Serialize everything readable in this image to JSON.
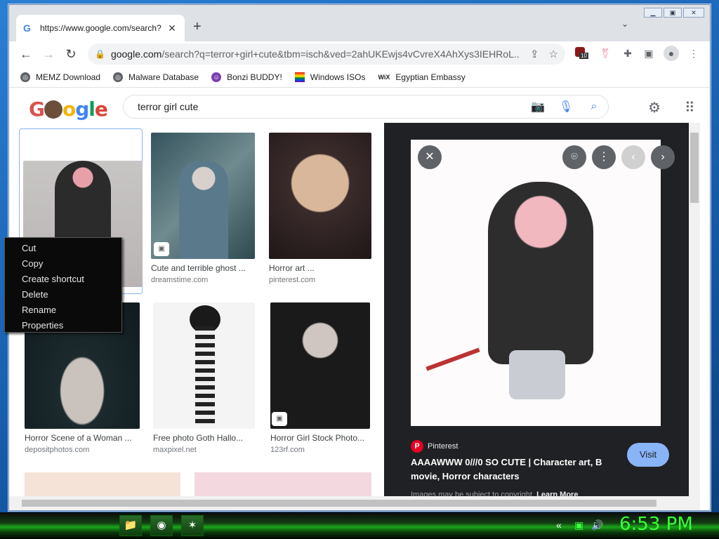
{
  "browser": {
    "tab": {
      "title": "https://www.google.com/search?",
      "favicon": "G"
    },
    "new_tab": "+",
    "tab_close": "✕",
    "caret": "⌄",
    "window_controls": [
      "▁",
      "▣",
      "✕"
    ],
    "url_host": "google.com",
    "url_rest": "/search?q=terror+girl+cute&tbm=isch&ved=2ahUKEwjs4vCvreX4AhXys3IEHRoL...",
    "extension_badge": "10",
    "bookmarks": [
      {
        "label": "MEMZ Download"
      },
      {
        "label": "Malware Database"
      },
      {
        "label": "Bonzi BUDDY!"
      },
      {
        "label": "Windows ISOs"
      },
      {
        "label": "Egyptian Embassy"
      }
    ],
    "bookmark_wix_prefix": "WiX"
  },
  "google": {
    "logo_letters": [
      "G",
      "o",
      "o",
      "g",
      "l",
      "e"
    ],
    "search_query": "terror girl cute"
  },
  "results": [
    {
      "caption": "",
      "source": ""
    },
    {
      "caption": "Cute and terrible ghost ...",
      "source": "dreamstime.com"
    },
    {
      "caption": "Horror art ...",
      "source": "pinterest.com"
    },
    {
      "caption": "Horror Scene of a Woman ...",
      "source": "depositphotos.com"
    },
    {
      "caption": "Free photo Goth Hallo...",
      "source": "maxpixel.net"
    },
    {
      "caption": "Horror Girl Stock Photo...",
      "source": "123rf.com"
    }
  ],
  "panel": {
    "source": "Pinterest",
    "title": "AAAAWWW 0///0 SO CUTE | Character art, B movie, Horror characters",
    "visit": "Visit",
    "copyright": "Images may be subject to copyright.",
    "learn_more": "Learn More"
  },
  "context_menu": [
    "Cut",
    "Copy",
    "Create shortcut",
    "Delete",
    "Rename",
    "Properties"
  ],
  "taskbar": {
    "clock": "6:53 PM"
  },
  "colors": {
    "accent": "#8ab4f8",
    "clock": "#39ff39",
    "panel_bg": "#202124"
  }
}
